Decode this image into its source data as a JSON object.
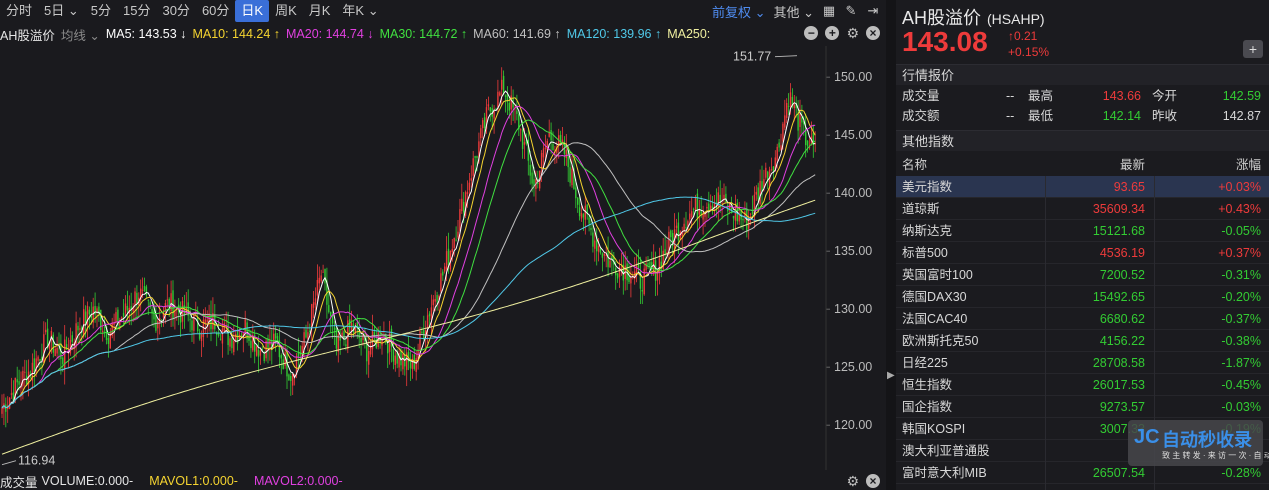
{
  "toolbar": {
    "periods": [
      "分时",
      "5日 ⌄",
      "5分",
      "15分",
      "30分",
      "60分",
      "日K",
      "周K",
      "月K",
      "年K ⌄"
    ],
    "active_period": "日K",
    "adjust": "前复权 ⌄",
    "more": "其他 ⌄"
  },
  "ma_bar": {
    "title": "AH股溢价",
    "avg_label": "均线 ⌄",
    "items": [
      {
        "text": "MA5: 143.53 ↓",
        "color": "#ffffff"
      },
      {
        "text": "MA10: 144.24 ↑",
        "color": "#f5d430"
      },
      {
        "text": "MA20: 144.74 ↓",
        "color": "#e040e0"
      },
      {
        "text": "MA30: 144.72 ↑",
        "color": "#40e040"
      },
      {
        "text": "MA60: 141.69 ↑",
        "color": "#c0c0c0"
      },
      {
        "text": "MA120: 139.96 ↑",
        "color": "#50c8e8"
      },
      {
        "text": "MA250:",
        "color": "#f0f0a0"
      }
    ]
  },
  "chart_data": {
    "type": "candlestick",
    "y_ticks": [
      "150.00",
      "145.00",
      "140.00",
      "135.00",
      "130.00",
      "125.00",
      "120.00"
    ],
    "ylim": [
      117,
      152
    ],
    "high_label": "151.77",
    "low_label": "116.94",
    "colors": {
      "up": "#ee3b3b",
      "down": "#33cc33",
      "ma5": "#ffffff",
      "ma10": "#f5d430",
      "ma20": "#e040e0",
      "ma30": "#40e040",
      "ma60": "#c0c0c0",
      "ma120": "#50c8e8",
      "ma250": "#f0f0a0"
    },
    "anchors": [
      [
        0,
        121.5
      ],
      [
        8,
        123.5
      ],
      [
        16,
        125
      ],
      [
        24,
        127.5
      ],
      [
        32,
        126
      ],
      [
        40,
        128.5
      ],
      [
        48,
        130
      ],
      [
        56,
        128
      ],
      [
        64,
        129.5
      ],
      [
        72,
        131.5
      ],
      [
        80,
        129
      ],
      [
        88,
        130.5
      ],
      [
        96,
        129.5
      ],
      [
        104,
        128.5
      ],
      [
        112,
        129
      ],
      [
        120,
        127.5
      ],
      [
        128,
        128.5
      ],
      [
        136,
        126.5
      ],
      [
        144,
        127
      ],
      [
        152,
        124.5
      ],
      [
        160,
        127.5
      ],
      [
        168,
        133
      ],
      [
        176,
        126.5
      ],
      [
        184,
        128.5
      ],
      [
        192,
        126.5
      ],
      [
        200,
        128
      ],
      [
        208,
        126
      ],
      [
        216,
        125
      ],
      [
        224,
        129.5
      ],
      [
        232,
        133
      ],
      [
        240,
        137.5
      ],
      [
        248,
        142.5
      ],
      [
        256,
        147
      ],
      [
        264,
        149
      ],
      [
        272,
        146
      ],
      [
        280,
        140.5
      ],
      [
        288,
        145
      ],
      [
        296,
        143.5
      ],
      [
        304,
        139
      ],
      [
        312,
        136
      ],
      [
        320,
        134
      ],
      [
        328,
        133.5
      ],
      [
        336,
        132.5
      ],
      [
        344,
        133.5
      ],
      [
        352,
        136
      ],
      [
        360,
        138
      ],
      [
        368,
        139
      ],
      [
        376,
        139.5
      ],
      [
        384,
        138.5
      ],
      [
        392,
        137.5
      ],
      [
        400,
        141
      ],
      [
        408,
        143.5
      ],
      [
        414,
        148.5
      ],
      [
        422,
        145
      ],
      [
        428,
        143.5
      ]
    ],
    "candle_spacing": 1.9
  },
  "volume_bar": {
    "label": "成交量",
    "volume": "VOLUME:0.000-",
    "mavol1": "MAVOL1:0.000-",
    "mavol2": "MAVOL2:0.000-"
  },
  "quote": {
    "name": "AH股溢价",
    "code": "(HSAHP)",
    "price": "143.08",
    "change": "0.21",
    "change_pct": "+0.15%"
  },
  "market_section": {
    "title": "行情报价",
    "rows": [
      {
        "l1": "成交量",
        "v1": "--",
        "l2": "最高",
        "v2": "143.66",
        "v2color": "up",
        "l3": "今开",
        "v3": "142.59",
        "v3color": "down"
      },
      {
        "l1": "成交额",
        "v1": "--",
        "l2": "最低",
        "v2": "142.14",
        "v2color": "down",
        "l3": "昨收",
        "v3": "142.87",
        "v3color": "neutral"
      }
    ]
  },
  "index_section": {
    "title": "其他指数",
    "col_name": "名称",
    "col_latest": "最新",
    "col_pct": "涨幅",
    "rows": [
      {
        "name": "美元指数",
        "latest": "93.65",
        "pct": "+0.03%",
        "dir": "up"
      },
      {
        "name": "道琼斯",
        "latest": "35609.34",
        "pct": "+0.43%",
        "dir": "up"
      },
      {
        "name": "纳斯达克",
        "latest": "15121.68",
        "pct": "-0.05%",
        "dir": "down"
      },
      {
        "name": "标普500",
        "latest": "4536.19",
        "pct": "+0.37%",
        "dir": "up"
      },
      {
        "name": "英国富时100",
        "latest": "7200.52",
        "pct": "-0.31%",
        "dir": "down"
      },
      {
        "name": "德国DAX30",
        "latest": "15492.65",
        "pct": "-0.20%",
        "dir": "down"
      },
      {
        "name": "法国CAC40",
        "latest": "6680.62",
        "pct": "-0.37%",
        "dir": "down"
      },
      {
        "name": "欧洲斯托克50",
        "latest": "4156.22",
        "pct": "-0.38%",
        "dir": "down"
      },
      {
        "name": "日经225",
        "latest": "28708.58",
        "pct": "-1.87%",
        "dir": "down"
      },
      {
        "name": "恒生指数",
        "latest": "26017.53",
        "pct": "-0.45%",
        "dir": "down"
      },
      {
        "name": "国企指数",
        "latest": "9273.57",
        "pct": "-0.03%",
        "dir": "down"
      },
      {
        "name": "韩国KOSPI",
        "latest": "3007.33",
        "pct": "-0.19%",
        "dir": "down"
      },
      {
        "name": "澳大利亚普通股",
        "latest": "",
        "pct": "",
        "dir": "down"
      },
      {
        "name": "富时意大利MIB",
        "latest": "26507.54",
        "pct": "-0.28%",
        "dir": "down"
      }
    ]
  },
  "watermark": {
    "logo": "JC",
    "title": "自动秒收录",
    "subtitle": "致 主 转 发 · 来 访 一 次 · 自 动 收 录"
  }
}
